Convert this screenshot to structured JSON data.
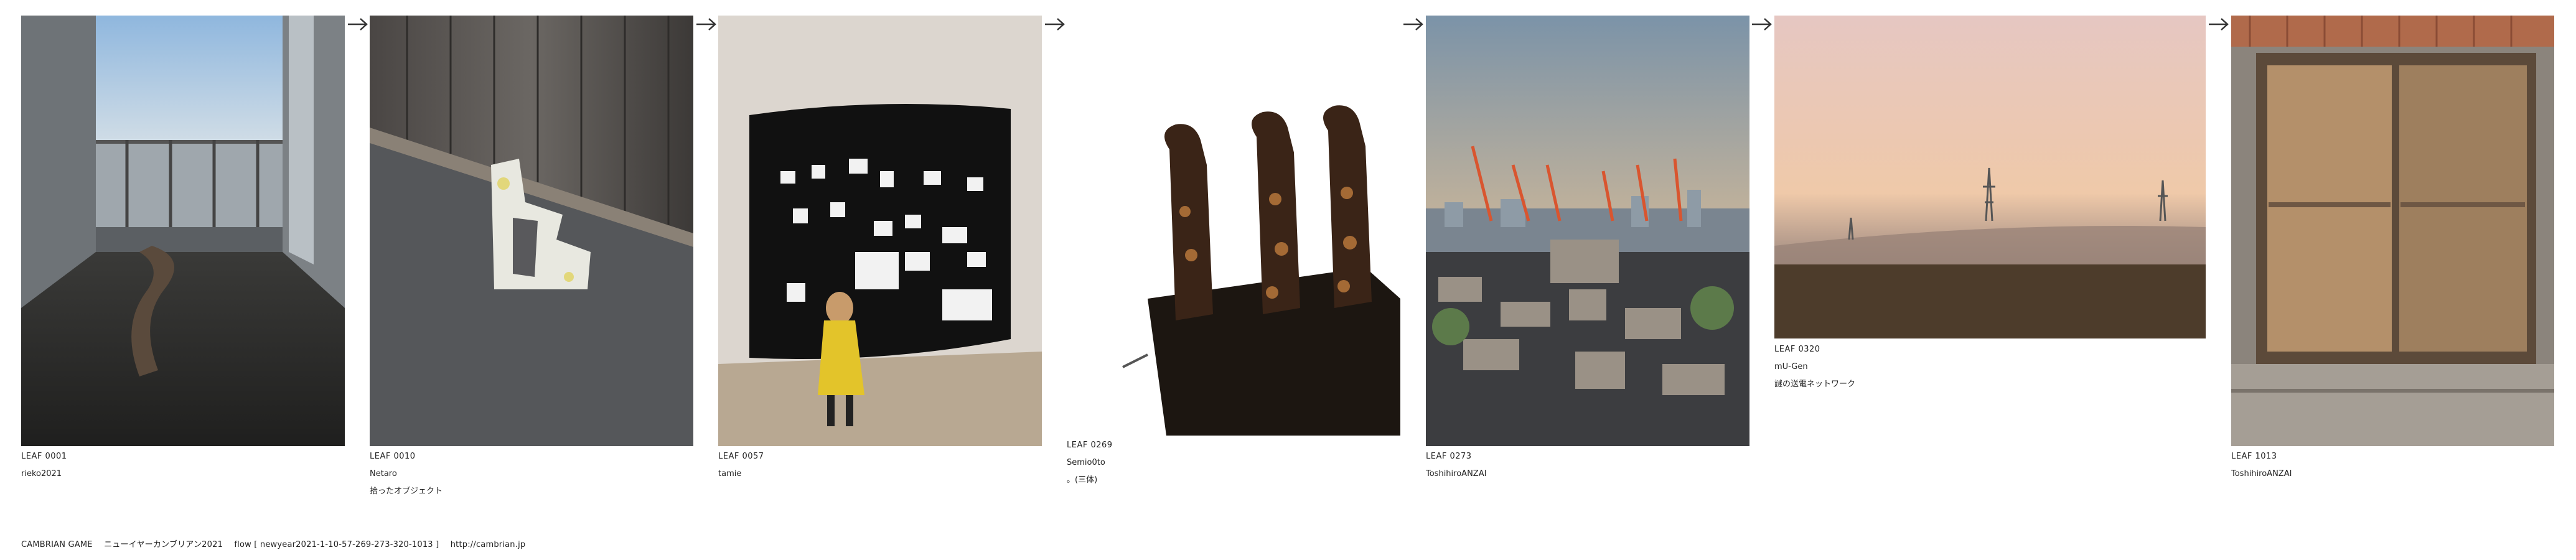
{
  "leaves": [
    {
      "id": "LEAF 0001",
      "author": "rieko2021",
      "title": ""
    },
    {
      "id": "LEAF 0010",
      "author": "Netaro",
      "title": "拾ったオブジェクト"
    },
    {
      "id": "LEAF 0057",
      "author": "tamie",
      "title": ""
    },
    {
      "id": "LEAF 0269",
      "author": "Semio0to",
      "title": "。(三体)"
    },
    {
      "id": "LEAF 0273",
      "author": "ToshihiroANZAI",
      "title": ""
    },
    {
      "id": "LEAF 0320",
      "author": "mU-Gen",
      "title": "謎の送電ネットワーク"
    },
    {
      "id": "LEAF 1013",
      "author": "ToshihiroANZAI",
      "title": ""
    }
  ],
  "arrow_icon": "arrow-right-icon",
  "footer": {
    "game": "CAMBRIAN GAME",
    "event": "ニューイヤーカンブリアン2021",
    "flow": "flow [ newyear2021-1-10-57-269-273-320-1013 ]",
    "url": "http://cambrian.jp"
  }
}
